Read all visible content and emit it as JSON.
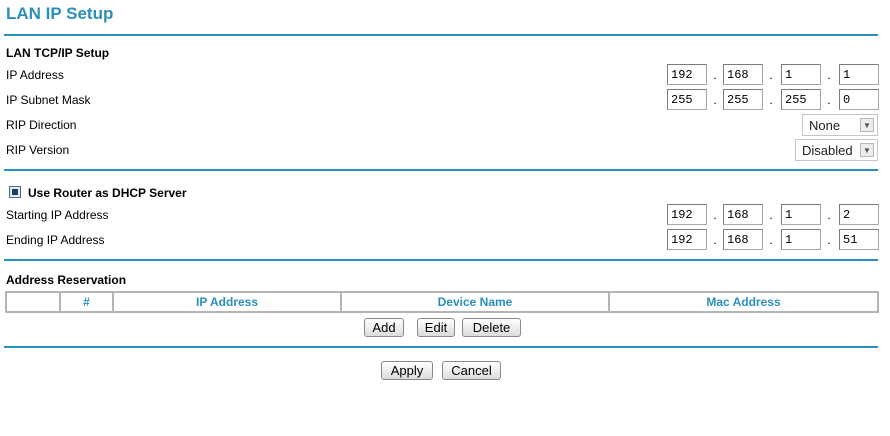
{
  "page": {
    "title": "LAN IP Setup"
  },
  "lan_tcpip": {
    "heading": "LAN TCP/IP Setup",
    "ip_address_label": "IP Address",
    "ip_address": [
      "192",
      "168",
      "1",
      "1"
    ],
    "subnet_mask_label": "IP Subnet Mask",
    "subnet_mask": [
      "255",
      "255",
      "255",
      "0"
    ],
    "rip_direction_label": "RIP Direction",
    "rip_direction_value": "None",
    "rip_version_label": "RIP Version",
    "rip_version_value": "Disabled"
  },
  "dhcp": {
    "use_router_label": "Use Router as DHCP Server",
    "use_router_checked": true,
    "starting_ip_label": "Starting IP Address",
    "starting_ip": [
      "192",
      "168",
      "1",
      "2"
    ],
    "ending_ip_label": "Ending IP Address",
    "ending_ip": [
      "192",
      "168",
      "1",
      "51"
    ]
  },
  "reservation": {
    "heading": "Address Reservation",
    "columns": [
      "",
      "#",
      "IP Address",
      "Device Name",
      "Mac Address"
    ],
    "add_label": "Add",
    "edit_label": "Edit",
    "delete_label": "Delete"
  },
  "actions": {
    "apply_label": "Apply",
    "cancel_label": "Cancel"
  },
  "colors": {
    "accent": "#2a8fbd",
    "table_border": "#b4b4b4"
  },
  "icons": {
    "dropdown": "chevron-down-icon",
    "checkbox": "checkbox-checked-icon"
  }
}
